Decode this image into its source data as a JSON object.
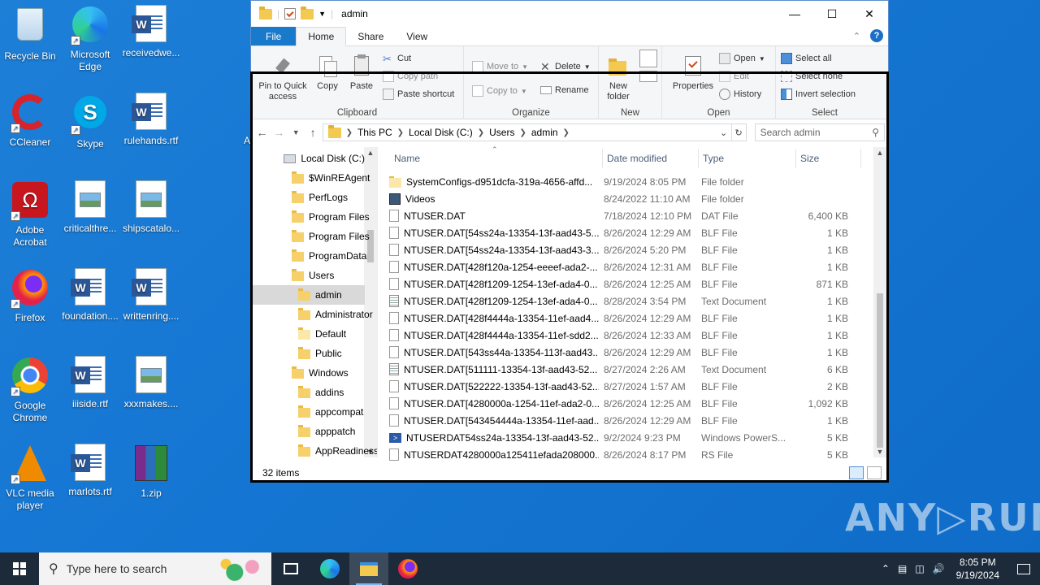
{
  "desktop": {
    "icons": [
      {
        "label": "Recycle Bin"
      },
      {
        "label": "Microsoft Edge"
      },
      {
        "label": "receivedwe..."
      },
      {
        "label": "CCleaner"
      },
      {
        "label": "Skype"
      },
      {
        "label": "rulehands.rtf"
      },
      {
        "label": "Adobe Acrobat"
      },
      {
        "label": "criticalthre..."
      },
      {
        "label": "shipscatalo..."
      },
      {
        "label": "Firefox"
      },
      {
        "label": "foundation...."
      },
      {
        "label": "writtenring...."
      },
      {
        "label": "Google Chrome"
      },
      {
        "label": "iiiside.rtf"
      },
      {
        "label": "xxxmakes...."
      },
      {
        "label": "VLC media player"
      },
      {
        "label": "marlots.rtf"
      },
      {
        "label": "1.zip"
      }
    ],
    "edge_label_fragment": "A"
  },
  "window": {
    "title": "admin",
    "controls": {
      "minimize": "—",
      "maximize": "☐",
      "close": "✕"
    },
    "tabs": {
      "file": "File",
      "home": "Home",
      "share": "Share",
      "view": "View"
    },
    "help": "?",
    "ribbon": {
      "clipboard": {
        "pin": "Pin to Quick access",
        "copy": "Copy",
        "paste": "Paste",
        "cut": "Cut",
        "copy_path": "Copy path",
        "paste_shortcut": "Paste shortcut",
        "group": "Clipboard"
      },
      "organize": {
        "move_to": "Move to",
        "delete": "Delete",
        "copy_to": "Copy to",
        "rename": "Rename",
        "group": "Organize"
      },
      "new": {
        "new_folder": "New folder",
        "group": "New"
      },
      "open": {
        "properties": "Properties",
        "open": "Open",
        "edit": "Edit",
        "history": "History",
        "group": "Open"
      },
      "select": {
        "select_all": "Select all",
        "select_none": "Select none",
        "invert": "Invert selection",
        "group": "Select"
      }
    },
    "address": {
      "crumbs": [
        "This PC",
        "Local Disk (C:)",
        "Users",
        "admin"
      ],
      "search_placeholder": "Search admin"
    },
    "nav": [
      {
        "label": "Local Disk (C:)",
        "level": 0
      },
      {
        "label": "$WinREAgent",
        "level": 1
      },
      {
        "label": "PerfLogs",
        "level": 1
      },
      {
        "label": "Program Files",
        "level": 1
      },
      {
        "label": "Program Files",
        "level": 1
      },
      {
        "label": "ProgramData",
        "level": 1
      },
      {
        "label": "Users",
        "level": 1
      },
      {
        "label": "admin",
        "level": 2
      },
      {
        "label": "Administrator",
        "level": 2
      },
      {
        "label": "Default",
        "level": 2
      },
      {
        "label": "Public",
        "level": 2
      },
      {
        "label": "Windows",
        "level": 1
      },
      {
        "label": "addins",
        "level": 2
      },
      {
        "label": "appcompat",
        "level": 2
      },
      {
        "label": "apppatch",
        "level": 2
      },
      {
        "label": "AppReadiness",
        "level": 2
      }
    ],
    "columns": {
      "name": "Name",
      "date": "Date modified",
      "type": "Type",
      "size": "Size"
    },
    "files": [
      {
        "name": "SystemConfigs-d951dcfa-319a-4656-affd...",
        "date": "9/19/2024 8:05 PM",
        "type": "File folder",
        "size": "",
        "icon": "folder"
      },
      {
        "name": "Videos",
        "date": "8/24/2022 11:10 AM",
        "type": "File folder",
        "size": "",
        "icon": "video"
      },
      {
        "name": "NTUSER.DAT",
        "date": "7/18/2024 12:10 PM",
        "type": "DAT File",
        "size": "6,400 KB",
        "icon": "file"
      },
      {
        "name": "NTUSER.DAT[54ss24a-13354-13f-aad43-5...",
        "date": "8/26/2024 12:29 AM",
        "type": "BLF File",
        "size": "1 KB",
        "icon": "file"
      },
      {
        "name": "NTUSER.DAT[54ss24a-13354-13f-aad43-3...",
        "date": "8/26/2024 5:20 PM",
        "type": "BLF File",
        "size": "1 KB",
        "icon": "file"
      },
      {
        "name": "NTUSER.DAT[428f120a-1254-eeeef-ada2-...",
        "date": "8/26/2024 12:31 AM",
        "type": "BLF File",
        "size": "1 KB",
        "icon": "file"
      },
      {
        "name": "NTUSER.DAT[428f1209-1254-13ef-ada4-0...",
        "date": "8/26/2024 12:25 AM",
        "type": "BLF File",
        "size": "871 KB",
        "icon": "file"
      },
      {
        "name": "NTUSER.DAT[428f1209-1254-13ef-ada4-0...",
        "date": "8/28/2024 3:54 PM",
        "type": "Text Document",
        "size": "1 KB",
        "icon": "text"
      },
      {
        "name": "NTUSER.DAT[428f4444a-13354-11ef-aad4...",
        "date": "8/26/2024 12:29 AM",
        "type": "BLF File",
        "size": "1 KB",
        "icon": "file"
      },
      {
        "name": "NTUSER.DAT[428f4444a-13354-11ef-sdd2...",
        "date": "8/26/2024 12:33 AM",
        "type": "BLF File",
        "size": "1 KB",
        "icon": "file"
      },
      {
        "name": "NTUSER.DAT[543ss44a-13354-113f-aad43...",
        "date": "8/26/2024 12:29 AM",
        "type": "BLF File",
        "size": "1 KB",
        "icon": "file"
      },
      {
        "name": "NTUSER.DAT[511111-13354-13f-aad43-52...",
        "date": "8/27/2024 2:26 AM",
        "type": "Text Document",
        "size": "6 KB",
        "icon": "text"
      },
      {
        "name": "NTUSER.DAT[522222-13354-13f-aad43-52...",
        "date": "8/27/2024 1:57 AM",
        "type": "BLF File",
        "size": "2 KB",
        "icon": "file"
      },
      {
        "name": "NTUSER.DAT[4280000a-1254-11ef-ada2-0...",
        "date": "8/26/2024 12:25 AM",
        "type": "BLF File",
        "size": "1,092 KB",
        "icon": "file"
      },
      {
        "name": "NTUSER.DAT[543454444a-13354-11ef-aad...",
        "date": "8/26/2024 12:29 AM",
        "type": "BLF File",
        "size": "1 KB",
        "icon": "file"
      },
      {
        "name": "NTUSERDAT54ss24a-13354-13f-aad43-52...",
        "date": "9/2/2024 9:23 PM",
        "type": "Windows PowerS...",
        "size": "5 KB",
        "icon": "ps"
      },
      {
        "name": "NTUSERDAT4280000a125411efada208000...",
        "date": "8/26/2024 8:17 PM",
        "type": "RS File",
        "size": "5 KB",
        "icon": "file"
      }
    ],
    "status": "32 items"
  },
  "taskbar": {
    "search_placeholder": "Type here to search",
    "time": "8:05 PM",
    "date": "9/19/2024"
  },
  "watermark": "ANY▷RUN"
}
